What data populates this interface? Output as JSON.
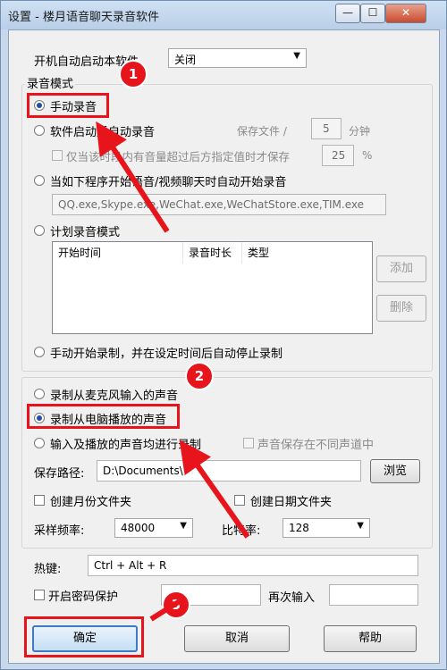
{
  "window": {
    "title": "设置 - 楼月语音聊天录音软件",
    "minimize": "—",
    "maximize": "☐",
    "close": "✕"
  },
  "startup": {
    "label": "开机自动启动本软件",
    "value": "关闭"
  },
  "record_mode": {
    "group_label": "录音模式",
    "manual": "手动录音",
    "auto_on_start": "软件启动后自动录音",
    "save_file_label": "保存文件 /",
    "save_minutes": "5",
    "minutes_unit": "分钟",
    "only_when_label": "仅当该时段内有音量超过后方指定值时才保存",
    "threshold": "25",
    "percent": "%",
    "auto_on_call": "当如下程序开始语音/视频聊天时自动开始录音",
    "programs": "QQ.exe,Skype.exe,WeChat.exe,WeChatStore.exe,TIM.exe",
    "scheduled": "计划录音模式",
    "columns": [
      "开始时间",
      "录音时长",
      "类型"
    ],
    "add_button": "添加",
    "delete_button": "删除",
    "manual_start_auto_stop": "手动开始录制，并在设定时间后自动停止录制"
  },
  "source": {
    "mic": "录制从麦克风输入的声音",
    "pc": "录制从电脑播放的声音",
    "both": "输入及播放的声音均进行录制",
    "separate_channels": "声音保存在不同声道中",
    "save_path_label": "保存路径:",
    "save_path": "D:\\Documents\\",
    "browse_button": "浏览",
    "monthly_folder": "创建月份文件夹",
    "daily_folder": "创建日期文件夹",
    "sample_rate_label": "采样频率:",
    "sample_rate": "48000",
    "bitrate_label": "比特率:",
    "bitrate": "128"
  },
  "hotkey": {
    "label": "热键:",
    "value": "Ctrl + Alt + R"
  },
  "password": {
    "enable_label": "开启密码保护",
    "confirm_label": "再次输入"
  },
  "buttons": {
    "ok": "确定",
    "cancel": "取消",
    "help": "帮助"
  },
  "annotations": {
    "step1": "1",
    "step2": "2",
    "step3": "3"
  },
  "colors": {
    "annotation_red": "#e8141c",
    "title_bar": "#c8d8ea"
  }
}
